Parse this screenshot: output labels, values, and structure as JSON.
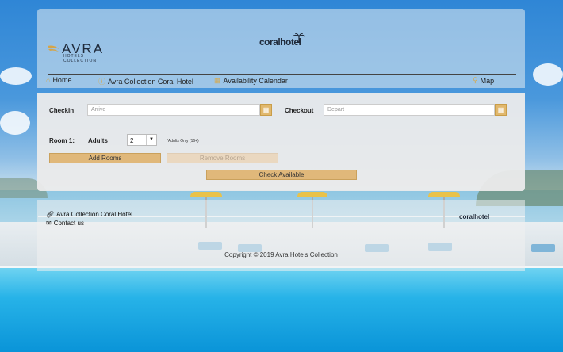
{
  "header": {
    "logo_avra": "AVRA",
    "logo_avra_sub": "HOTELS COLLECTION",
    "logo_coral": "coralhotel"
  },
  "nav": {
    "items": [
      {
        "label": "Home",
        "icon": "home-icon"
      },
      {
        "label": "Avra Collection Coral Hotel",
        "icon": "info-icon"
      },
      {
        "label": "Availability Calendar",
        "icon": "calendar-icon"
      },
      {
        "label": "Map",
        "icon": "map-pin-icon"
      }
    ]
  },
  "booking": {
    "checkin_label": "Checkin",
    "checkin_placeholder": "Arrive",
    "checkout_label": "Checkout",
    "checkout_placeholder": "Depart",
    "room_label": "Room 1:",
    "adults_label": "Adults",
    "adults_value": "2",
    "adults_note": "*Adults Only (16+)",
    "add_rooms": "Add Rooms",
    "remove_rooms": "Remove Rooms",
    "check_available": "Check Available"
  },
  "footer": {
    "link_hotel": "Avra Collection Coral Hotel",
    "link_contact": "Contact us",
    "logo_coral": "coralhotel",
    "copyright": "Copyright © 2019 Avra Hotels Collection"
  },
  "colors": {
    "accent": "#e0b87a",
    "icon": "#d9a949"
  }
}
